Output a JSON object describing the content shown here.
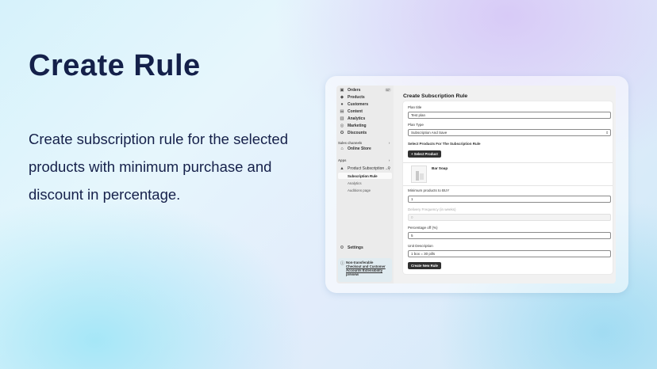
{
  "hero": {
    "title": "Create Rule",
    "description": "Create subscription rule for the selected products with minimum purchase and discount in percentage."
  },
  "sidebar": {
    "nav": [
      {
        "label": "Orders",
        "icon": "inbox-icon",
        "badge": "57"
      },
      {
        "label": "Products",
        "icon": "tag-icon"
      },
      {
        "label": "Customers",
        "icon": "person-icon"
      },
      {
        "label": "Content",
        "icon": "document-icon"
      },
      {
        "label": "Analytics",
        "icon": "chart-icon"
      },
      {
        "label": "Marketing",
        "icon": "target-icon"
      },
      {
        "label": "Discounts",
        "icon": "discount-icon"
      }
    ],
    "sales_channels": {
      "label": "Sales channels",
      "items": [
        {
          "label": "Online Store",
          "icon": "store-icon"
        }
      ]
    },
    "apps": {
      "label": "Apps",
      "app_name": "Product Subscription ...",
      "sub_items": [
        "Subscription Rule",
        "Analytics",
        "Auditions page"
      ]
    },
    "settings": {
      "label": "Settings",
      "icon": "gear-icon"
    },
    "notice": {
      "prefix": "Non-transferable",
      "link": "Checkout and Customer Accounts Extensibility",
      "suffix": "preview"
    }
  },
  "form": {
    "page_title": "Create Subscription Rule",
    "plan_title_label": "Plan title",
    "plan_title_value": "Test plan",
    "plan_type_label": "Plan Type",
    "plan_type_value": "Subscription And Save",
    "products_heading": "Select Products For The Subscription Rule",
    "select_product_button": "+ Select Product",
    "product_name": "Bar Soap",
    "min_products_label": "Minimum products to BUY",
    "min_products_value": "1",
    "delivery_label": "Delivery Frequency (in weeks)",
    "delivery_value": "0",
    "percentage_label": "Percentage off (%)",
    "percentage_value": "5",
    "unit_label": "Unit Description",
    "unit_value": "1 box = 30 pills",
    "create_button": "Create New Rule"
  }
}
